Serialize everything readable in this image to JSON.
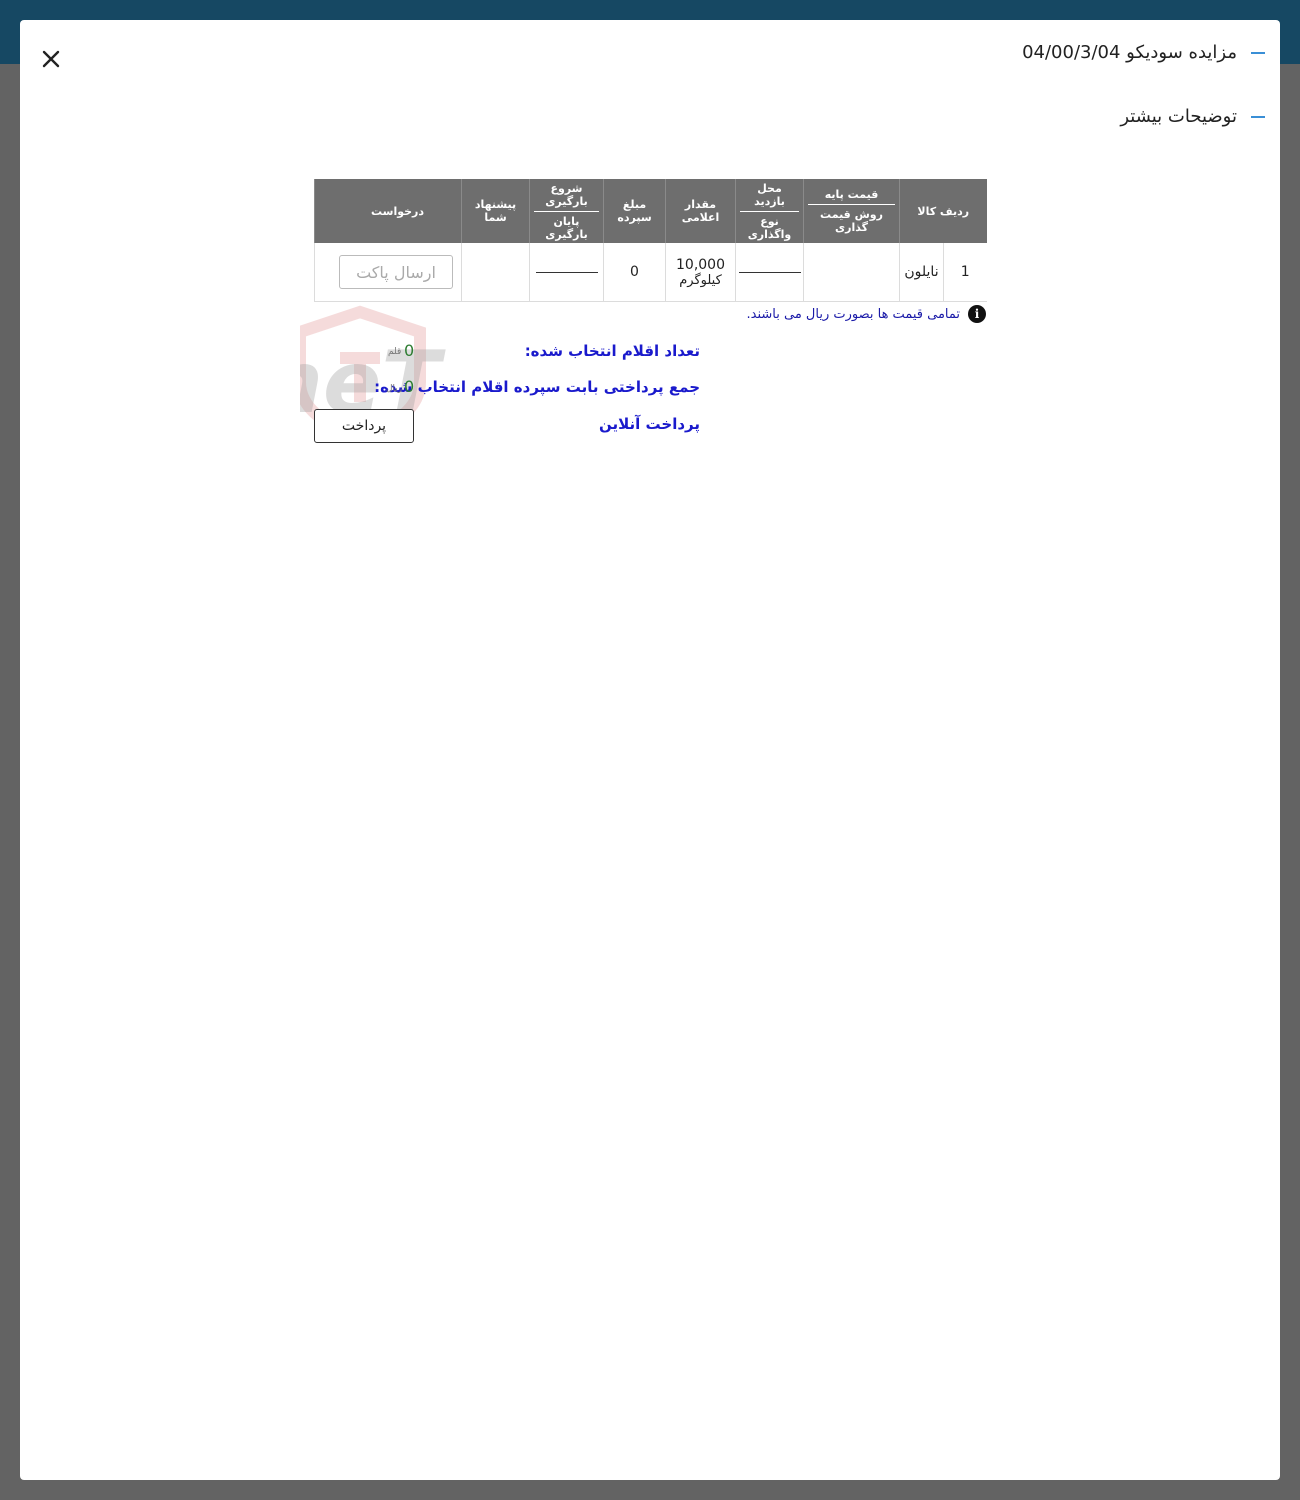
{
  "header": {
    "title": "مزایده سودیکو 04/00/3/04",
    "more_info": "توضیحات بیشتر"
  },
  "table": {
    "headers": {
      "row_item": "ردیف کالا",
      "base_price": "قیمت پایه",
      "pricing_method": "روش قیمت گذاری",
      "visit_location": "محل بازدید",
      "assignment_type": "نوع واگذاری",
      "announced_amount": "مقدار اعلامی",
      "deposit_amount": "مبلغ سپرده",
      "loading_start": "شروع بارگیری",
      "loading_end": "پایان بارگیری",
      "your_offer": "پیشنهاد شما",
      "request": "درخواست"
    },
    "rows": [
      {
        "row": "1",
        "item": "نایلون",
        "base_price": "",
        "visit": "",
        "amount": "10,000",
        "unit": "کیلوگرم",
        "deposit": "0",
        "loading": "",
        "offer": "",
        "send_button": "ارسال پاکت"
      }
    ]
  },
  "note": "تمامی قیمت ها بصورت ریال می باشند.",
  "summary": {
    "selected_count_label": "تعداد اقلام انتخاب شده:",
    "selected_count_value": "0",
    "selected_count_unit": "قلم",
    "deposit_total_label": "جمع پرداختی بابت سپرده اقلام انتخاب شده:",
    "deposit_total_value": "0",
    "deposit_total_unit": "ریال",
    "online_payment_label": "پرداخت آنلاین",
    "pay_button": "پرداخت"
  },
  "watermark_text": "AriaTender.neT"
}
